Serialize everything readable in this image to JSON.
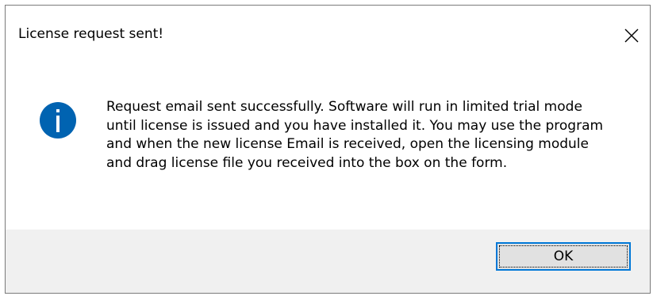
{
  "dialog": {
    "title": "License request sent!",
    "close_glyph": "close-icon",
    "icon": "info-icon",
    "message": "Request email sent successfully. Software will run in limited trial mode until license is issued and you have installed it. You may use the program and when the new license Email is received, open the licensing module and drag license file you received into the box on the form.",
    "ok_label": "OK"
  },
  "colors": {
    "accent": "#0078d7",
    "info_icon": "#0063b1",
    "footer_bg": "#f0f0f0",
    "button_bg": "#e1e1e1"
  }
}
